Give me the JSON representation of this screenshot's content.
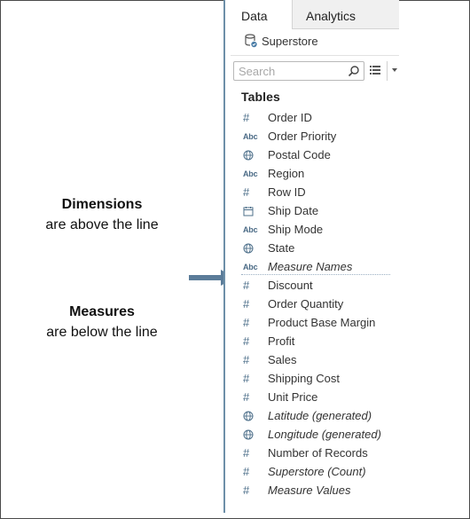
{
  "annotations": {
    "dimensions_title": "Dimensions",
    "dimensions_sub": "are above the line",
    "measures_title": "Measures",
    "measures_sub": "are below the line"
  },
  "panel": {
    "tabs": [
      {
        "label": "Data",
        "active": true
      },
      {
        "label": "Analytics",
        "active": false
      }
    ],
    "datasource": "Superstore",
    "search_placeholder": "Search",
    "section_title": "Tables",
    "fields": [
      {
        "label": "Order ID",
        "icon": "number-icon",
        "italic": false
      },
      {
        "label": "Order Priority",
        "icon": "string-icon",
        "italic": false
      },
      {
        "label": "Postal Code",
        "icon": "globe-icon",
        "italic": false
      },
      {
        "label": "Region",
        "icon": "string-icon",
        "italic": false
      },
      {
        "label": "Row ID",
        "icon": "number-icon",
        "italic": false
      },
      {
        "label": "Ship Date",
        "icon": "calendar-icon",
        "italic": false
      },
      {
        "label": "Ship Mode",
        "icon": "string-icon",
        "italic": false
      },
      {
        "label": "State",
        "icon": "globe-icon",
        "italic": false
      },
      {
        "label": "Measure Names",
        "icon": "string-icon",
        "italic": true
      },
      {
        "label": "Discount",
        "icon": "number-icon",
        "italic": false
      },
      {
        "label": "Order Quantity",
        "icon": "number-icon",
        "italic": false
      },
      {
        "label": "Product Base Margin",
        "icon": "number-icon",
        "italic": false
      },
      {
        "label": "Profit",
        "icon": "number-icon",
        "italic": false
      },
      {
        "label": "Sales",
        "icon": "number-icon",
        "italic": false
      },
      {
        "label": "Shipping Cost",
        "icon": "number-icon",
        "italic": false
      },
      {
        "label": "Unit Price",
        "icon": "number-icon",
        "italic": false
      },
      {
        "label": "Latitude (generated)",
        "icon": "globe-icon",
        "italic": true
      },
      {
        "label": "Longitude (generated)",
        "icon": "globe-icon",
        "italic": true
      },
      {
        "label": "Number of Records",
        "icon": "number-icon",
        "italic": false
      },
      {
        "label": "Superstore (Count)",
        "icon": "number-icon",
        "italic": true
      },
      {
        "label": "Measure Values",
        "icon": "number-icon",
        "italic": true
      }
    ],
    "icon_glyphs": {
      "string-icon": "Abc",
      "number-icon": "#"
    },
    "colors": {
      "icon": "#4d6f8a",
      "arrow": "#5b7c99",
      "panel_border": "#6d8fa8"
    }
  }
}
